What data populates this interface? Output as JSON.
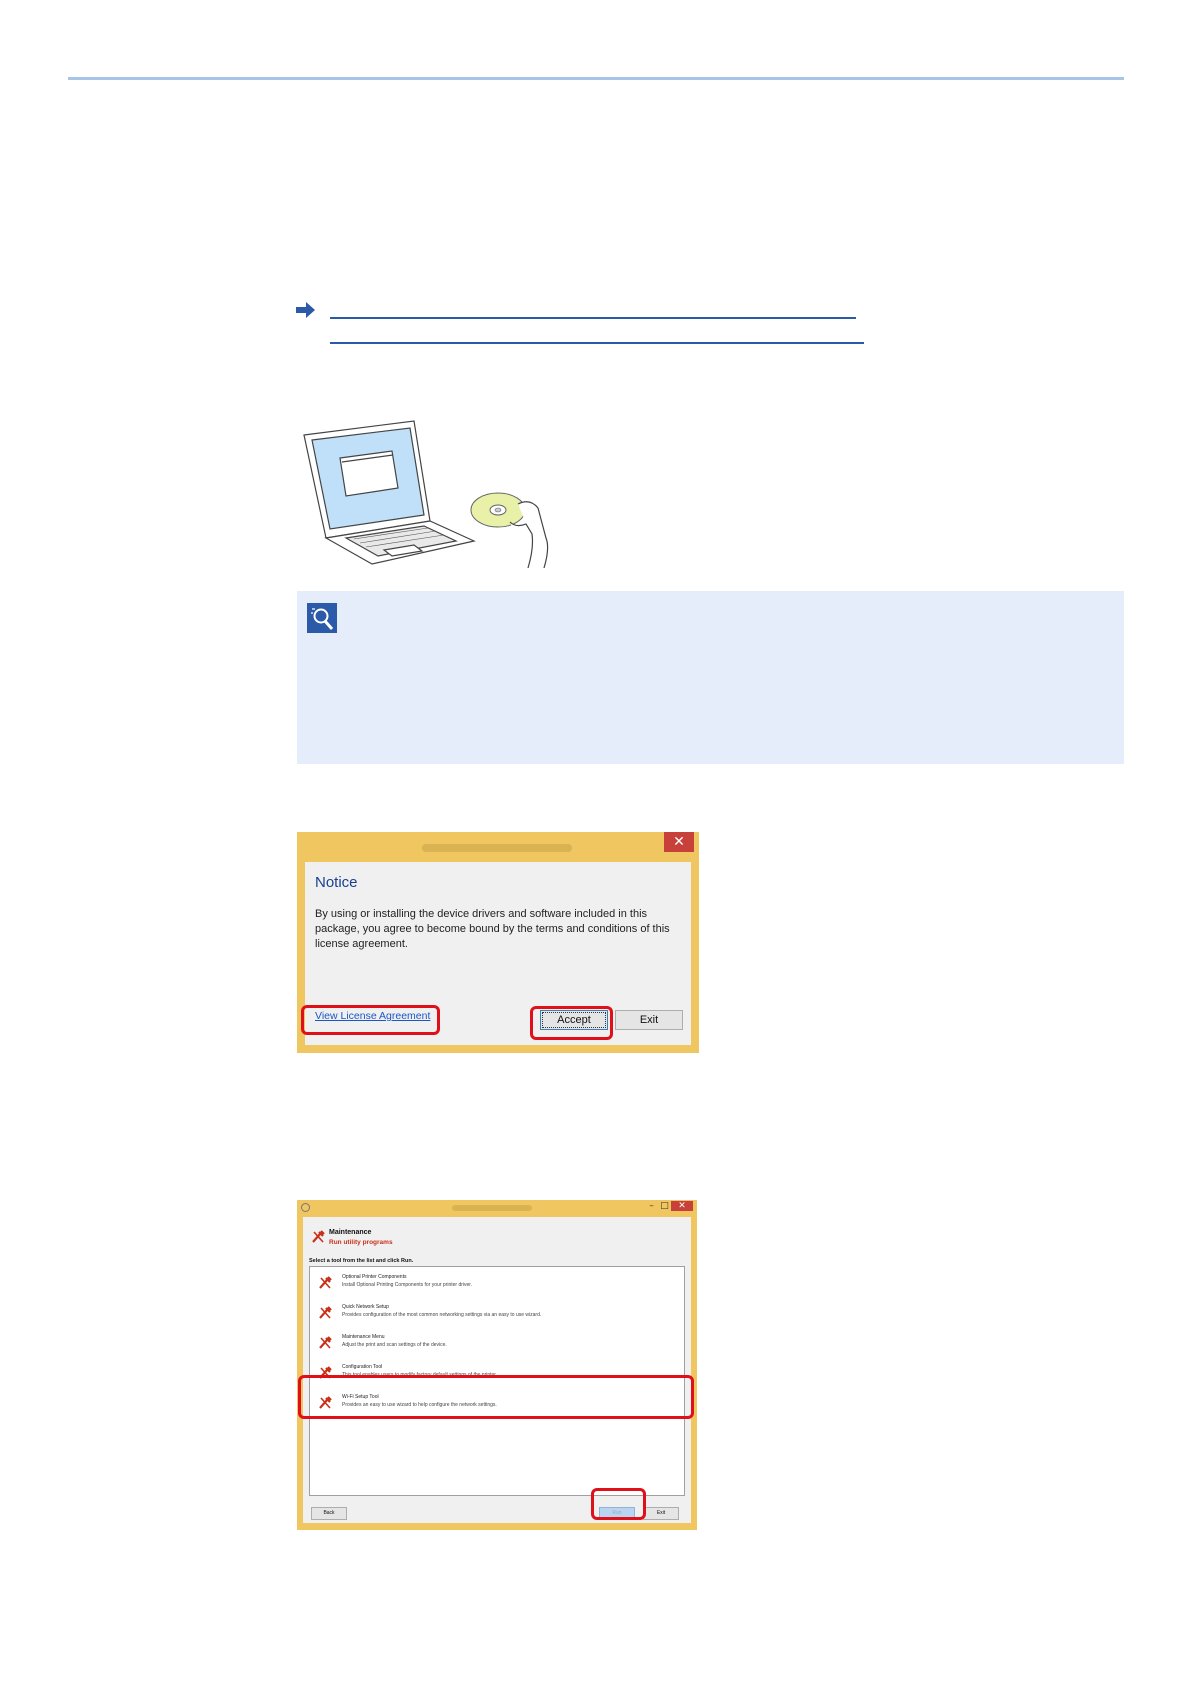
{
  "colors": {
    "accent": "#2a5aa8",
    "highlight": "#e0101a",
    "note_bg": "#e6edfa"
  },
  "notice_dialog": {
    "close_glyph": "✕",
    "heading": "Notice",
    "body_text": "By using or installing the device drivers and software included in this package, you agree to become bound by the terms and conditions of this license agreement.",
    "license_link": "View License Agreement",
    "accept_label": "Accept",
    "exit_label": "Exit"
  },
  "library_dialog": {
    "minimize_glyph": "–",
    "maximize_glyph": "□",
    "close_glyph": "✕",
    "section_title": "Maintenance",
    "section_subtitle": "Run utility programs",
    "instruction": "Select a tool from the list and click Run.",
    "tools": [
      {
        "name": "Optional Printer Components",
        "description": "Install Optional Printing Components for your printer driver."
      },
      {
        "name": "Quick Network Setup",
        "description": "Provides configuration of the most common networking settings via an easy to use wizard."
      },
      {
        "name": "Maintenance Menu",
        "description": "Adjust the print and scan settings of the device."
      },
      {
        "name": "Configuration Tool",
        "description": "This tool enables users to modify factory default settings of the printer."
      },
      {
        "name": "Wi-Fi Setup Tool",
        "description": "Provides an easy to use wizard to help configure the network settings."
      }
    ],
    "back_label": "Back",
    "run_label": "Run",
    "exit_label": "Exit"
  }
}
